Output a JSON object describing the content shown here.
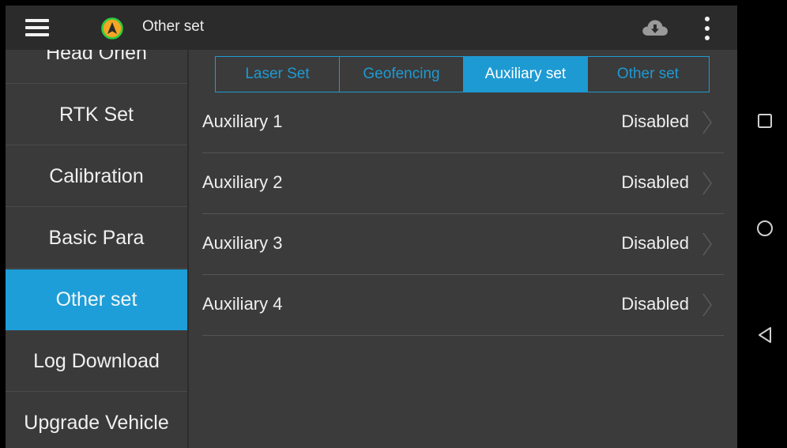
{
  "header": {
    "title": "Other set",
    "icons": {
      "menu": "hamburger-menu-icon",
      "nav": "navigation-arrow-icon",
      "cloud": "cloud-download-icon",
      "more": "more-vert-icon"
    }
  },
  "sidebar": {
    "items": [
      {
        "label": "Head Orien",
        "active": false
      },
      {
        "label": "RTK Set",
        "active": false
      },
      {
        "label": "Calibration",
        "active": false
      },
      {
        "label": "Basic Para",
        "active": false
      },
      {
        "label": "Other set",
        "active": true
      },
      {
        "label": "Log Download",
        "active": false
      },
      {
        "label": "Upgrade Vehicle",
        "active": false
      }
    ]
  },
  "tabs": [
    {
      "label": "Laser Set",
      "active": false
    },
    {
      "label": "Geofencing",
      "active": false
    },
    {
      "label": "Auxiliary set",
      "active": true
    },
    {
      "label": "Other set",
      "active": false
    }
  ],
  "auxiliary": {
    "rows": [
      {
        "label": "Auxiliary 1",
        "value": "Disabled"
      },
      {
        "label": "Auxiliary 2",
        "value": "Disabled"
      },
      {
        "label": "Auxiliary 3",
        "value": "Disabled"
      },
      {
        "label": "Auxiliary 4",
        "value": "Disabled"
      }
    ]
  },
  "system_nav": {
    "icons": [
      "recent-apps-icon",
      "home-icon",
      "back-icon"
    ]
  },
  "colors": {
    "accent": "#1e9ad3",
    "background": "#3b3b3b",
    "topbar": "#2b2b2b",
    "nav_icon": "#f5a623",
    "nav_icon_ring": "#2ecc40"
  }
}
